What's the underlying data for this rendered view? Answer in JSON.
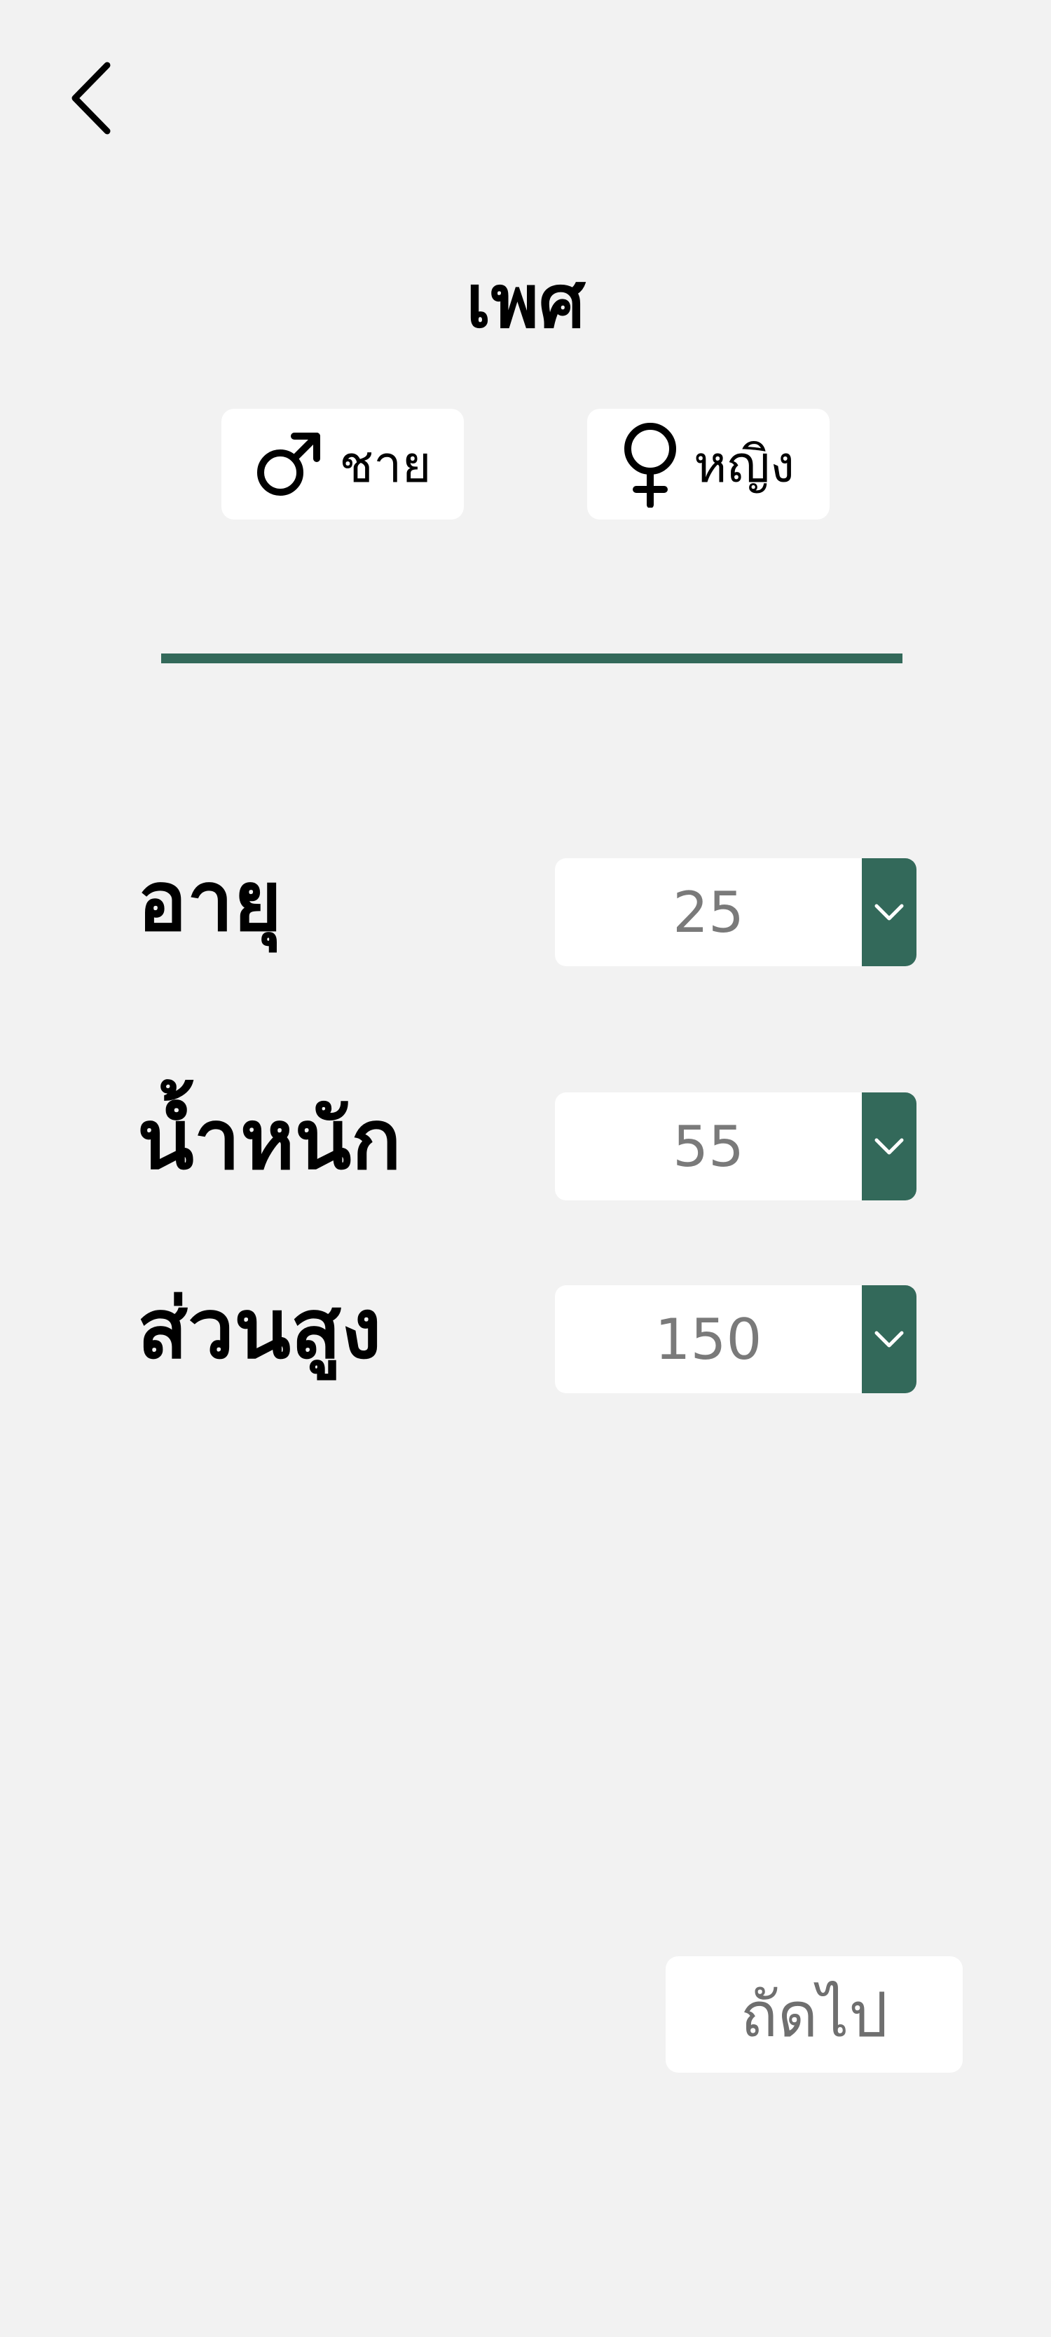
{
  "header": {
    "back_icon": "chevron-left-icon"
  },
  "gender": {
    "title": "เพศ",
    "options": [
      {
        "label": "ชาย",
        "icon": "male-symbol-icon"
      },
      {
        "label": "หญิง",
        "icon": "female-symbol-icon"
      }
    ]
  },
  "fields": {
    "age": {
      "label": "อายุ",
      "value": "25"
    },
    "weight": {
      "label": "น้ำหนัก",
      "value": "55"
    },
    "height": {
      "label": "ส่วนสูง",
      "value": "150"
    }
  },
  "footer": {
    "next_label": "ถัดไป"
  },
  "colors": {
    "accent": "#33695a",
    "background": "#f2f2f2",
    "surface": "#ffffff",
    "muted_text": "#7a7a7a"
  }
}
